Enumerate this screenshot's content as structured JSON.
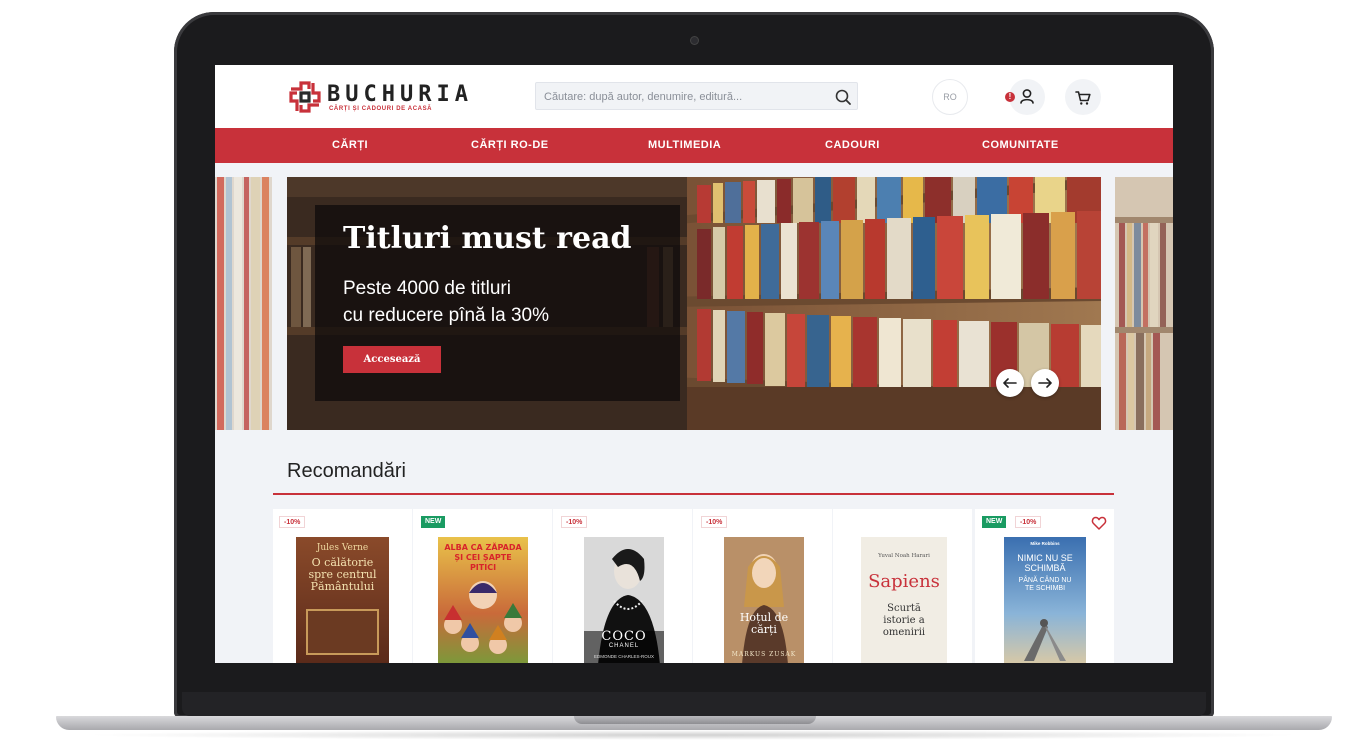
{
  "brand": {
    "name": "BUCHURIA",
    "tagline": "CĂRȚI ȘI CADOURI DE ACASĂ",
    "accent_color": "#c8313a"
  },
  "header": {
    "search_placeholder": "Căutare: după autor, denumire, editură...",
    "lang_label": "RO",
    "alert_glyph": "!"
  },
  "nav": {
    "items": [
      {
        "label": "CĂRȚI"
      },
      {
        "label": "CĂRȚI RO-DE"
      },
      {
        "label": "MULTIMEDIA"
      },
      {
        "label": "CADOURI"
      },
      {
        "label": "COMUNITATE"
      }
    ]
  },
  "hero": {
    "title": "Titluri must read",
    "subtitle_line1": "Peste 4000 de titluri",
    "subtitle_line2": "cu reducere pînă la 30%",
    "cta_label": "Accesează"
  },
  "recommendations": {
    "title": "Recomandări",
    "items": [
      {
        "badges": [
          "-10%"
        ],
        "cover_author": "Jules Verne",
        "cover_title": "O călătorie spre centrul Pământului"
      },
      {
        "badges": [
          "NEW"
        ],
        "cover_title": "ALBA CA ZĂPADA ȘI CEI ȘAPTE PITICI"
      },
      {
        "badges": [
          "-10%"
        ],
        "cover_title": "COCO",
        "cover_subtitle": "CHANEL",
        "cover_author": "EDMONDE CHARLES-ROUX"
      },
      {
        "badges": [
          "-10%"
        ],
        "cover_title": "Hoțul de cărți",
        "cover_author": "MARKUS ZUSAK"
      },
      {
        "badges": [],
        "cover_author": "Yuval Noah Harari",
        "cover_title": "Sapiens",
        "cover_subtitle": "Scurtă istorie a omenirii"
      },
      {
        "badges": [
          "NEW",
          "-10%"
        ],
        "cover_author": "Mike Robbins",
        "cover_title": "NIMIC NU SE SCHIMBĂ",
        "cover_subtitle": "PÂNĂ CÂND NU TE SCHIMBI",
        "favorite": true
      }
    ]
  }
}
